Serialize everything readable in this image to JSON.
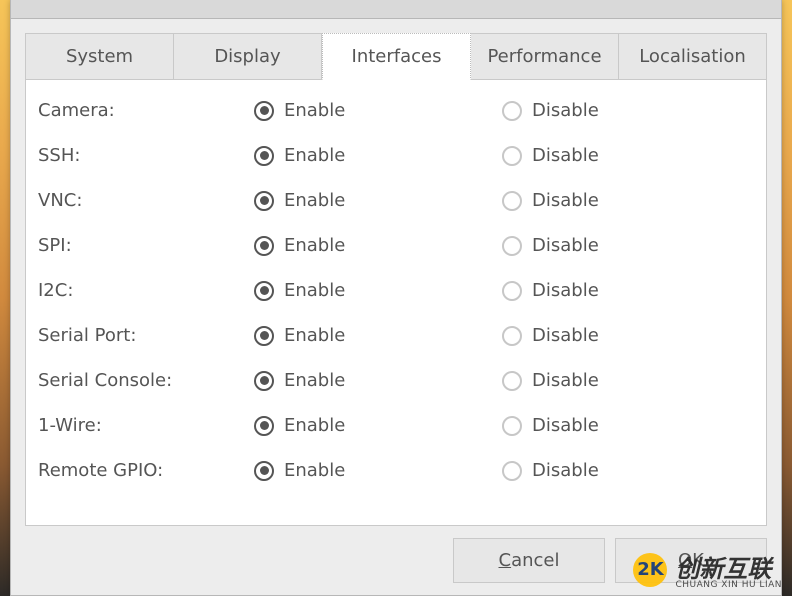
{
  "tabs": [
    {
      "label": "System"
    },
    {
      "label": "Display"
    },
    {
      "label": "Interfaces",
      "active": true
    },
    {
      "label": "Performance"
    },
    {
      "label": "Localisation"
    }
  ],
  "interfaces": {
    "enable_label": "Enable",
    "disable_label": "Disable",
    "rows": [
      {
        "label": "Camera:",
        "selected": "enable"
      },
      {
        "label": "SSH:",
        "selected": "enable"
      },
      {
        "label": "VNC:",
        "selected": "enable"
      },
      {
        "label": "SPI:",
        "selected": "enable"
      },
      {
        "label": "I2C:",
        "selected": "enable"
      },
      {
        "label": "Serial Port:",
        "selected": "enable"
      },
      {
        "label": "Serial Console:",
        "selected": "enable"
      },
      {
        "label": "1-Wire:",
        "selected": "enable"
      },
      {
        "label": "Remote GPIO:",
        "selected": "enable"
      }
    ]
  },
  "buttons": {
    "cancel": "Cancel",
    "ok": "OK"
  },
  "watermark": {
    "logo": "2K",
    "brand": "创新互联",
    "sub": "CHUANG XIN HU LIAN"
  }
}
